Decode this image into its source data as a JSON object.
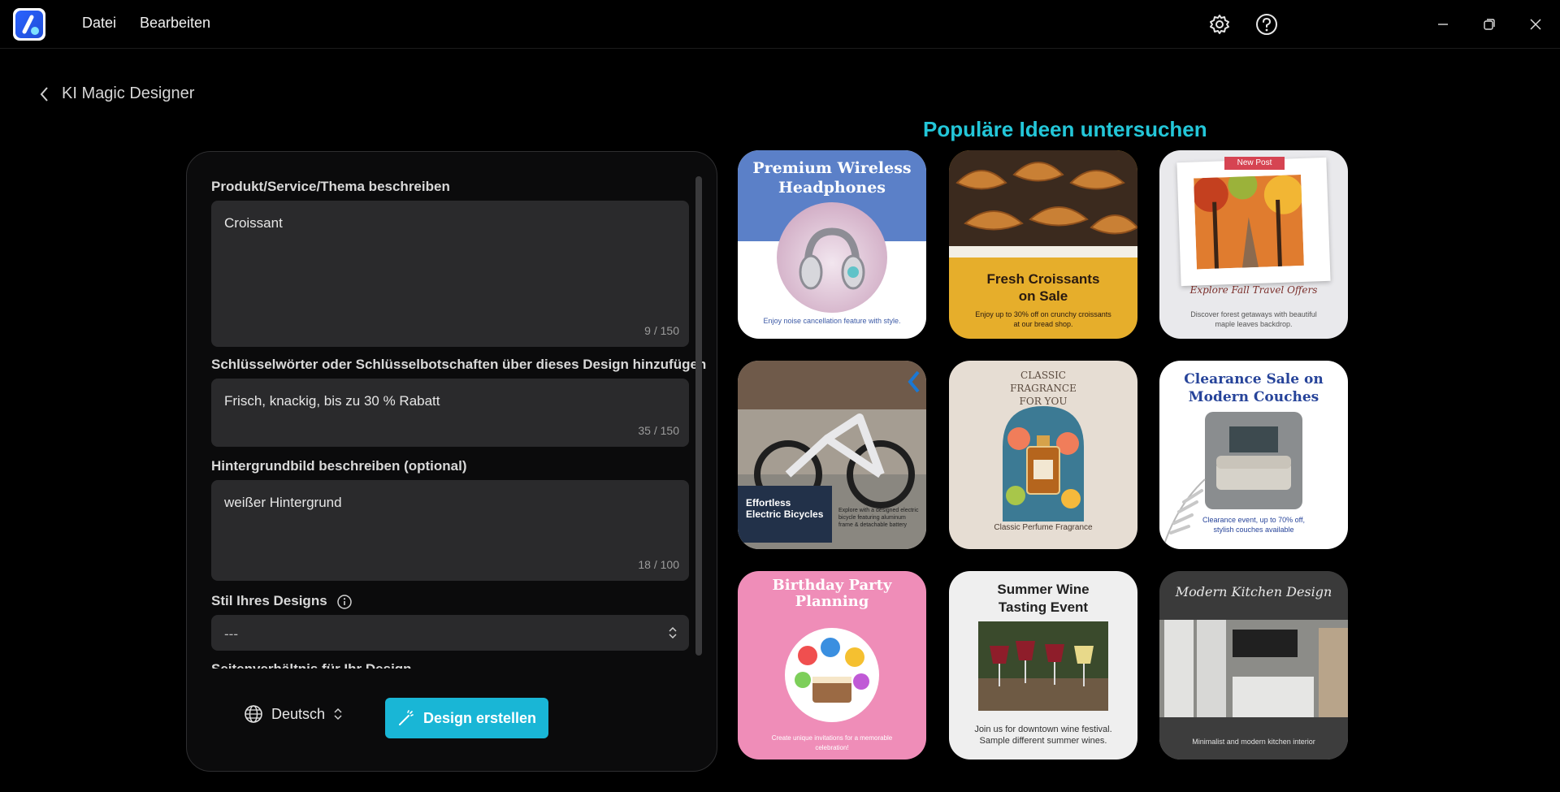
{
  "app": {
    "menu": [
      "Datei",
      "Bearbeiten"
    ]
  },
  "header": {
    "back_label": "KI Magic Designer"
  },
  "form": {
    "describe_label": "Produkt/Service/Thema beschreiben",
    "describe_value": "Croissant",
    "describe_count": "9 / 150",
    "keywords_label": "Schlüsselwörter oder Schlüsselbotschaften über dieses Design hinzufügen",
    "keywords_value": "Frisch, knackig, bis zu 30 % Rabatt",
    "keywords_count": "35 / 150",
    "background_label": "Hintergrundbild beschreiben (optional)",
    "background_value": "weißer Hintergrund",
    "background_count": "18 / 100",
    "style_label": "Stil Ihres Designs",
    "style_value": "---",
    "ratio_label": "Seitenverhältnis für Ihr Design"
  },
  "footer": {
    "language": "Deutsch",
    "create_button": "Design erstellen"
  },
  "ideas": {
    "title": "Populäre Ideen untersuchen",
    "cards": [
      {
        "title": "Premium Wireless Headphones",
        "sub": "Enjoy noise cancellation feature with style."
      },
      {
        "title": "Fresh Croissants on Sale",
        "sub": "Enjoy up to 30% off on crunchy croissants at our bread shop."
      },
      {
        "badge": "New Post",
        "title": "Explore Fall Travel Offers",
        "sub": "Discover forest getaways with beautiful maple leaves backdrop."
      },
      {
        "title": "Effortless Electric Bicycles",
        "sub": "Explore with a designed electric bicycle featuring aluminum frame & detachable battery"
      },
      {
        "title": "CLASSIC FRAGRANCE FOR YOU",
        "sub": "Classic Perfume Fragrance"
      },
      {
        "title": "Clearance Sale on Modern Couches",
        "sub": "Clearance event, up to 70% off, stylish couches available"
      },
      {
        "title": "Birthday Party Planning",
        "sub": "Create unique invitations for a memorable celebration!"
      },
      {
        "title": "Summer Wine Tasting Event",
        "sub": "Join us for downtown wine festival. Sample different summer wines."
      },
      {
        "title": "Modern Kitchen Design",
        "sub": "Minimalist and modern kitchen interior"
      }
    ]
  }
}
